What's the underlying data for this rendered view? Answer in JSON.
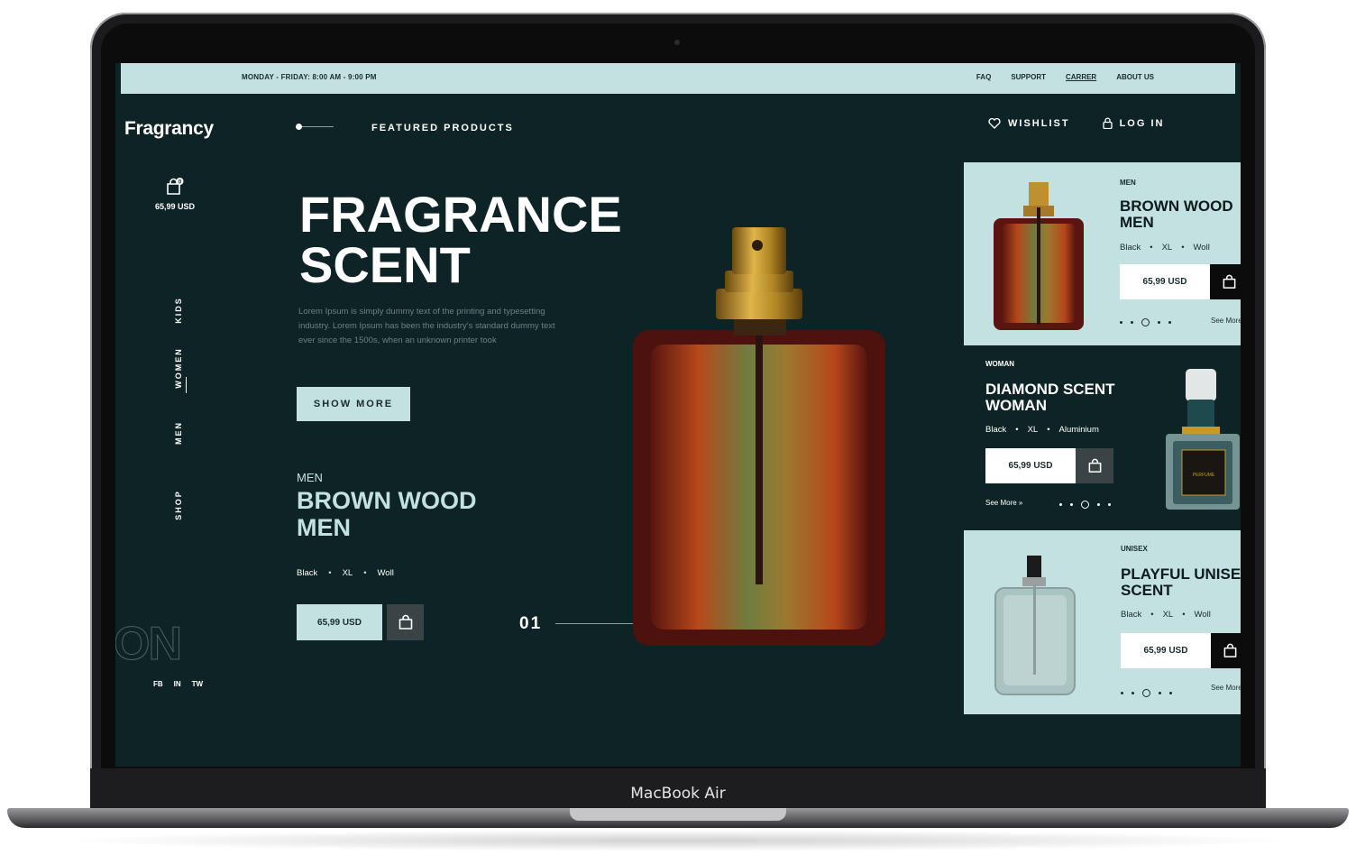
{
  "device": {
    "label": "MacBook Air"
  },
  "topbar": {
    "hours": "MONDAY - FRIDAY: 8:00 AM - 9:00 PM",
    "links": [
      "FAQ",
      "SUPPORT",
      "CARRER",
      "ABOUT US"
    ]
  },
  "brand": {
    "logo": "Fragrancy"
  },
  "nav": {
    "featured": "FEATURED PRODUCTS",
    "wishlist": "WISHLIST",
    "login": "LOG IN",
    "vertical": [
      "KIDS",
      "WOMEN",
      "MEN",
      "SHOP"
    ],
    "active": "WOMEN"
  },
  "cart": {
    "badge": "0",
    "total": "65,99 USD"
  },
  "social": [
    "FB",
    "IN",
    "TW"
  ],
  "ghost_text": "ON",
  "hero": {
    "title_line1": "FRAGRANCE",
    "title_line2": "SCENT",
    "description": "Lorem Ipsum is simply dummy text of the printing and typesetting industry. Lorem Ipsum has been the industry's standard dummy text ever since the 1500s, when an unknown printer took",
    "cta": "SHOW MORE"
  },
  "featured_product": {
    "category": "MEN",
    "title_line1": "BROWN WOOD",
    "title_line2": "MEN",
    "attrs": [
      "Black",
      "XL",
      "Woll"
    ],
    "price": "65,99 USD",
    "index": "01"
  },
  "cards": [
    {
      "category": "MEN",
      "title_line1": "BROWN WOOD",
      "title_line2": "MEN",
      "attrs": [
        "Black",
        "XL",
        "Woll"
      ],
      "price": "65,99 USD",
      "see_more": "See More"
    },
    {
      "category": "WOMAN",
      "title_line1": "DIAMOND SCENT",
      "title_line2": "WOMAN",
      "attrs": [
        "Black",
        "XL",
        "Aluminium"
      ],
      "price": "65,99 USD",
      "see_more": "See More",
      "bottle_label": "PERFUME"
    },
    {
      "category": "UNISEX",
      "title_line1": "PLAYFUL UNISEX",
      "title_line2": "SCENT",
      "attrs": [
        "Black",
        "XL",
        "Woll"
      ],
      "price": "65,99 USD",
      "see_more": "See More"
    }
  ],
  "colors": {
    "background": "#0e2326",
    "accent": "#c3e1e1",
    "dark_button": "#3a4446"
  }
}
